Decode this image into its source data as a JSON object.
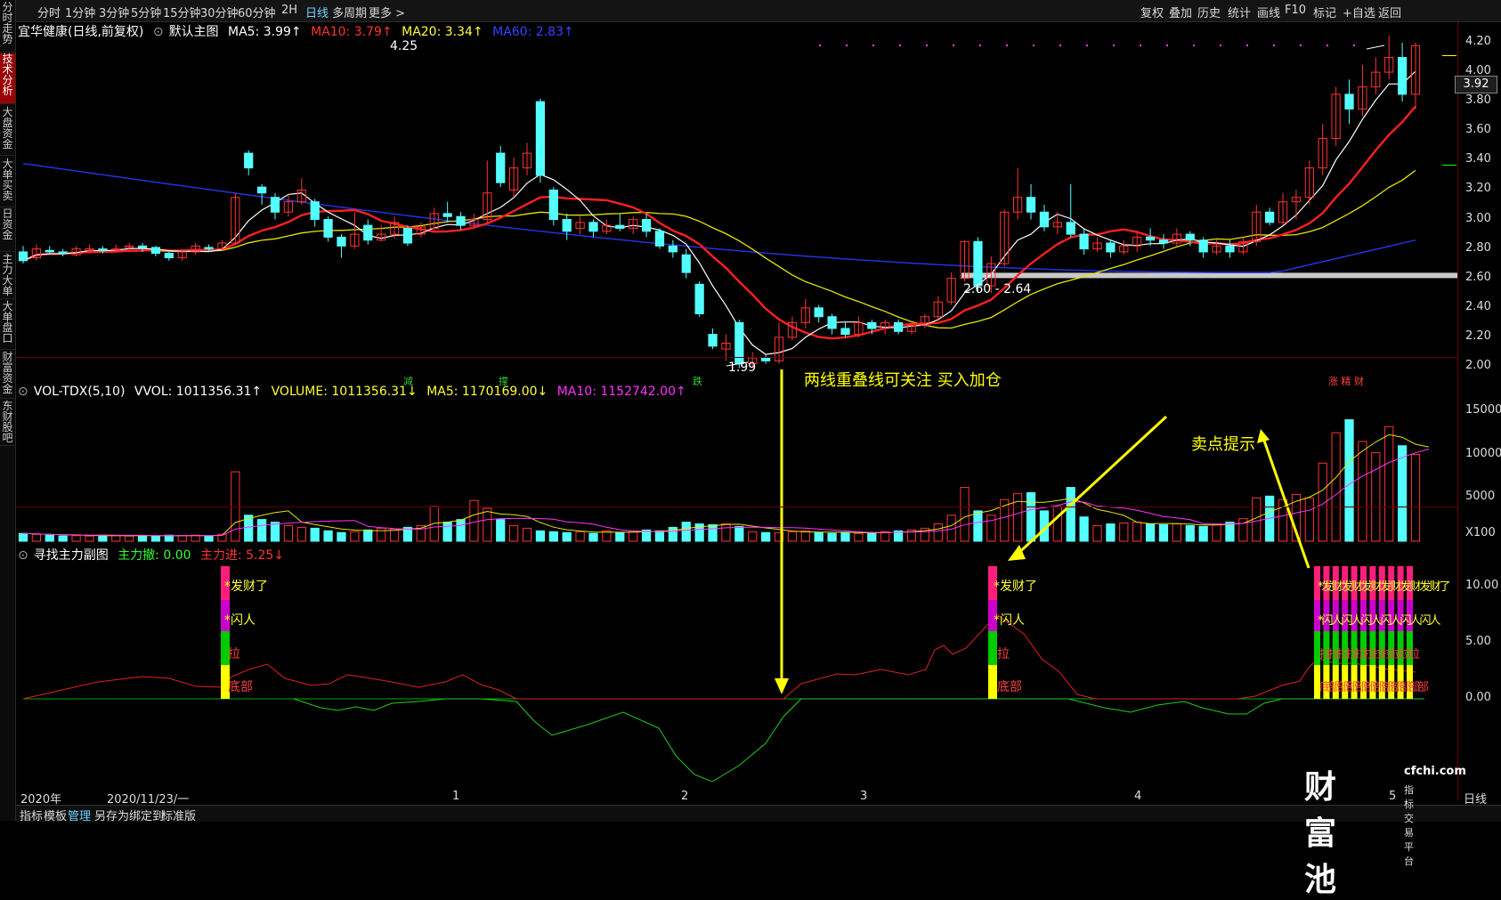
{
  "toolbar": {
    "periods": [
      "分时",
      "1分钟",
      "3分钟",
      "5分钟",
      "15分钟",
      "30分钟",
      "60分钟",
      "2H",
      "日线",
      "多周期",
      "更多 >"
    ],
    "active_period": "日线",
    "right_items": [
      "复权",
      "叠加",
      "历史",
      "统计",
      "画线",
      "F10",
      "标记",
      "+自选",
      "返回"
    ]
  },
  "left_tabs": [
    {
      "label": "分时走势"
    },
    {
      "label": "技术分析"
    },
    {
      "label": "大盘资金"
    },
    {
      "label": "大单买卖"
    },
    {
      "label": "日资金"
    },
    {
      "label": "主力大单"
    },
    {
      "label": "大单盘口"
    },
    {
      "label": "财富资金"
    },
    {
      "label": "东财股吧"
    }
  ],
  "main_legend": {
    "stock": "宜华健康(日线,前复权)",
    "template": "默认主图",
    "ma5": "MA5: 3.99↑",
    "ma10": "MA10: 3.79↑",
    "ma20": "MA20: 3.34↑",
    "ma60": "MA60: 2.83↑"
  },
  "vol_legend": {
    "name": "VOL-TDX(5,10)",
    "vvol": "VVOL: 1011356.31↑",
    "volume": "VOLUME: 1011356.31↓",
    "ma5": "MA5: 1170169.00↓",
    "ma10": "MA10: 1152742.00↑"
  },
  "sub_legend": {
    "name": "寻找主力副图",
    "withdraw": "主力撤: 0.00",
    "enter": "主力进: 5.25↓"
  },
  "main_yaxis": [
    "4.20",
    "4.00",
    "3.80",
    "3.60",
    "3.40",
    "3.20",
    "3.00",
    "2.80",
    "2.60",
    "2.40",
    "2.20",
    "2.00"
  ],
  "current_price": "3.92",
  "vol_yaxis": [
    "15000",
    "10000",
    "5000",
    "X100"
  ],
  "sub_yaxis": [
    "10.00",
    "5.00",
    "0.00"
  ],
  "xaxis": [
    "2020年",
    "2020/11/23/一",
    "1",
    "2",
    "3",
    "4",
    "5",
    "日线"
  ],
  "annotations": {
    "high": "4.25",
    "low": "1.99",
    "range": "2.60 - 2.64",
    "two_lines": "两线重叠线可关注  买入加仓",
    "sell": "卖点提示"
  },
  "event_tags": [
    {
      "text": "减",
      "color": "#33cc33"
    },
    {
      "text": "撑",
      "color": "#33cc33"
    },
    {
      "text": "跌",
      "color": "#33cc33"
    },
    {
      "text": "涨 精 财",
      "color": "#ff4040"
    }
  ],
  "signal_labels": {
    "rich": "*发财了",
    "flash": "*闪人",
    "pull": "拉",
    "bottom": "底部",
    "rich_repeat": "*发财发财发财发财发财发财了",
    "flash_repeat": "*闪人闪人闪人闪人闪人闪人",
    "pull_repeat": "拉拉拉拉拉拉拉拉拉拉拉",
    "bottom_repeat": "底部部部部部部部部部部部"
  },
  "bottom_bar": [
    "指标",
    "模板",
    "管理",
    "另存为",
    "绑定到",
    "标准版"
  ],
  "bottom_active": "管理",
  "watermark": {
    "big": "财富池",
    "domain": "cfchi.com",
    "tagline": "指标交易平台"
  },
  "colors": {
    "up": "#ff3333",
    "down": "#54ffff",
    "ma5": "#ffffff",
    "ma10": "#ff2020",
    "ma20": "#e6e600",
    "ma60": "#2233dd",
    "green_sig": "#00cc00",
    "magenta_sig": "#ff00ff",
    "yellow_sig": "#ffff00"
  },
  "chart_data": {
    "type": "candlestick",
    "price_ylim": [
      1.95,
      4.3
    ],
    "candles": [
      [
        2.78,
        2.72,
        2.82,
        2.7
      ],
      [
        2.74,
        2.8,
        2.83,
        2.72
      ],
      [
        2.79,
        2.78,
        2.82,
        2.76
      ],
      [
        2.78,
        2.77,
        2.8,
        2.75
      ],
      [
        2.76,
        2.8,
        2.82,
        2.75
      ],
      [
        2.79,
        2.8,
        2.83,
        2.77
      ],
      [
        2.8,
        2.79,
        2.82,
        2.77
      ],
      [
        2.8,
        2.8,
        2.83,
        2.78
      ],
      [
        2.81,
        2.82,
        2.84,
        2.79
      ],
      [
        2.82,
        2.81,
        2.84,
        2.78
      ],
      [
        2.81,
        2.77,
        2.82,
        2.75
      ],
      [
        2.77,
        2.74,
        2.78,
        2.72
      ],
      [
        2.74,
        2.78,
        2.8,
        2.72
      ],
      [
        2.78,
        2.82,
        2.84,
        2.76
      ],
      [
        2.81,
        2.8,
        2.83,
        2.78
      ],
      [
        2.8,
        2.84,
        2.86,
        2.79
      ],
      [
        2.84,
        3.15,
        3.18,
        2.83
      ],
      [
        3.45,
        3.35,
        3.47,
        3.3
      ],
      [
        3.22,
        3.18,
        3.24,
        3.1
      ],
      [
        3.15,
        3.05,
        3.18,
        3.0
      ],
      [
        3.05,
        3.12,
        3.17,
        3.02
      ],
      [
        3.12,
        3.2,
        3.28,
        3.1
      ],
      [
        3.12,
        3.0,
        3.14,
        2.95
      ],
      [
        3.0,
        2.88,
        3.02,
        2.85
      ],
      [
        2.88,
        2.82,
        2.9,
        2.74
      ],
      [
        2.82,
        2.9,
        3.05,
        2.8
      ],
      [
        2.96,
        2.86,
        3.0,
        2.83
      ],
      [
        2.86,
        2.9,
        2.96,
        2.85
      ],
      [
        2.9,
        2.98,
        3.02,
        2.87
      ],
      [
        2.94,
        2.84,
        2.96,
        2.82
      ],
      [
        2.9,
        2.95,
        2.98,
        2.88
      ],
      [
        2.94,
        3.04,
        3.08,
        2.92
      ],
      [
        3.04,
        3.02,
        3.12,
        2.98
      ],
      [
        3.02,
        2.96,
        3.05,
        2.93
      ],
      [
        2.96,
        3.0,
        3.04,
        2.94
      ],
      [
        3.0,
        3.18,
        3.4,
        2.98
      ],
      [
        3.45,
        3.25,
        3.5,
        3.22
      ],
      [
        3.2,
        3.35,
        3.42,
        3.15
      ],
      [
        3.35,
        3.45,
        3.52,
        3.3
      ],
      [
        3.8,
        3.3,
        3.82,
        3.25
      ],
      [
        3.2,
        3.0,
        3.22,
        2.96
      ],
      [
        3.0,
        2.92,
        3.04,
        2.86
      ],
      [
        2.94,
        2.98,
        3.02,
        2.9
      ],
      [
        2.98,
        2.92,
        3.0,
        2.88
      ],
      [
        2.92,
        2.96,
        3.0,
        2.9
      ],
      [
        2.96,
        2.94,
        3.04,
        2.92
      ],
      [
        2.94,
        3.0,
        3.02,
        2.9
      ],
      [
        3.0,
        2.92,
        3.04,
        2.88
      ],
      [
        2.92,
        2.82,
        2.94,
        2.8
      ],
      [
        2.82,
        2.78,
        2.86,
        2.74
      ],
      [
        2.76,
        2.64,
        2.8,
        2.6
      ],
      [
        2.56,
        2.36,
        2.58,
        2.34
      ],
      [
        2.22,
        2.14,
        2.26,
        2.12
      ],
      [
        2.12,
        2.16,
        2.22,
        2.04
      ],
      [
        2.3,
        2.02,
        2.32,
        1.99
      ],
      [
        2.02,
        2.06,
        2.1,
        2.0
      ],
      [
        2.06,
        2.04,
        2.08,
        2.02
      ],
      [
        2.04,
        2.2,
        2.3,
        2.02
      ],
      [
        2.2,
        2.3,
        2.34,
        2.18
      ],
      [
        2.3,
        2.4,
        2.46,
        2.26
      ],
      [
        2.4,
        2.34,
        2.42,
        2.3
      ],
      [
        2.34,
        2.26,
        2.36,
        2.22
      ],
      [
        2.26,
        2.22,
        2.3,
        2.2
      ],
      [
        2.22,
        2.3,
        2.34,
        2.2
      ],
      [
        2.3,
        2.26,
        2.32,
        2.22
      ],
      [
        2.26,
        2.3,
        2.32,
        2.22
      ],
      [
        2.3,
        2.24,
        2.32,
        2.22
      ],
      [
        2.24,
        2.28,
        2.3,
        2.22
      ],
      [
        2.28,
        2.34,
        2.36,
        2.26
      ],
      [
        2.34,
        2.44,
        2.48,
        2.32
      ],
      [
        2.44,
        2.6,
        2.64,
        2.42
      ],
      [
        2.6,
        2.85,
        2.86,
        2.58
      ],
      [
        2.85,
        2.55,
        2.88,
        2.5
      ],
      [
        2.55,
        2.7,
        2.75,
        2.5
      ],
      [
        2.7,
        3.05,
        3.07,
        2.68
      ],
      [
        3.05,
        3.15,
        3.35,
        3.0
      ],
      [
        3.15,
        3.05,
        3.24,
        3.0
      ],
      [
        3.05,
        2.95,
        3.1,
        2.92
      ],
      [
        2.95,
        2.98,
        3.05,
        2.9
      ],
      [
        2.98,
        2.9,
        3.24,
        2.88
      ],
      [
        2.9,
        2.8,
        2.94,
        2.76
      ],
      [
        2.8,
        2.84,
        2.88,
        2.78
      ],
      [
        2.84,
        2.78,
        2.86,
        2.74
      ],
      [
        2.78,
        2.82,
        2.86,
        2.76
      ],
      [
        2.82,
        2.88,
        2.92,
        2.78
      ],
      [
        2.88,
        2.86,
        2.94,
        2.82
      ],
      [
        2.86,
        2.84,
        2.9,
        2.8
      ],
      [
        2.84,
        2.9,
        2.94,
        2.82
      ],
      [
        2.9,
        2.86,
        2.92,
        2.82
      ],
      [
        2.86,
        2.78,
        2.88,
        2.74
      ],
      [
        2.78,
        2.82,
        2.86,
        2.76
      ],
      [
        2.82,
        2.78,
        2.86,
        2.74
      ],
      [
        2.78,
        2.85,
        2.88,
        2.76
      ],
      [
        2.85,
        3.05,
        3.1,
        2.82
      ],
      [
        3.05,
        2.98,
        3.08,
        2.96
      ],
      [
        2.98,
        3.12,
        3.18,
        2.96
      ],
      [
        3.12,
        3.15,
        3.2,
        3.0
      ],
      [
        3.15,
        3.35,
        3.4,
        3.1
      ],
      [
        3.35,
        3.55,
        3.65,
        3.3
      ],
      [
        3.55,
        3.85,
        3.9,
        3.5
      ],
      [
        3.85,
        3.75,
        3.95,
        3.65
      ],
      [
        3.75,
        3.9,
        4.05,
        3.7
      ],
      [
        3.9,
        4.0,
        4.1,
        3.85
      ],
      [
        4.0,
        4.1,
        4.25,
        3.95
      ],
      [
        4.1,
        3.85,
        4.2,
        3.8
      ],
      [
        3.85,
        4.18,
        4.2,
        3.75
      ]
    ],
    "volume_ylim": [
      0,
      16000
    ],
    "volume": [
      900,
      800,
      700,
      600,
      650,
      600,
      700,
      650,
      600,
      650,
      600,
      700,
      650,
      700,
      600,
      800,
      8000,
      3000,
      2500,
      2200,
      1800,
      1600,
      1500,
      1200,
      1000,
      1100,
      1300,
      1500,
      1400,
      1600,
      1800,
      4000,
      2200,
      2500,
      4700,
      3800,
      2500,
      1800,
      1500,
      1200,
      1100,
      1000,
      1100,
      900,
      1200,
      1000,
      1100,
      1300,
      1200,
      1600,
      2200,
      2000,
      1900,
      2000,
      1700,
      1100,
      1000,
      1000,
      1100,
      1200,
      1000,
      900,
      1000,
      900,
      1000,
      1100,
      1200,
      1300,
      1500,
      2000,
      3000,
      6200,
      3500,
      3000,
      4800,
      5500,
      5600,
      3500,
      4000,
      6200,
      2800,
      1800,
      2000,
      2100,
      2200,
      2000,
      1900,
      2000,
      1800,
      1700,
      2000,
      2200,
      2600,
      5000,
      5200,
      4800,
      5400,
      5000,
      9000,
      12500,
      14000,
      11500,
      10200,
      13200,
      11000,
      10000,
      9900
    ]
  }
}
